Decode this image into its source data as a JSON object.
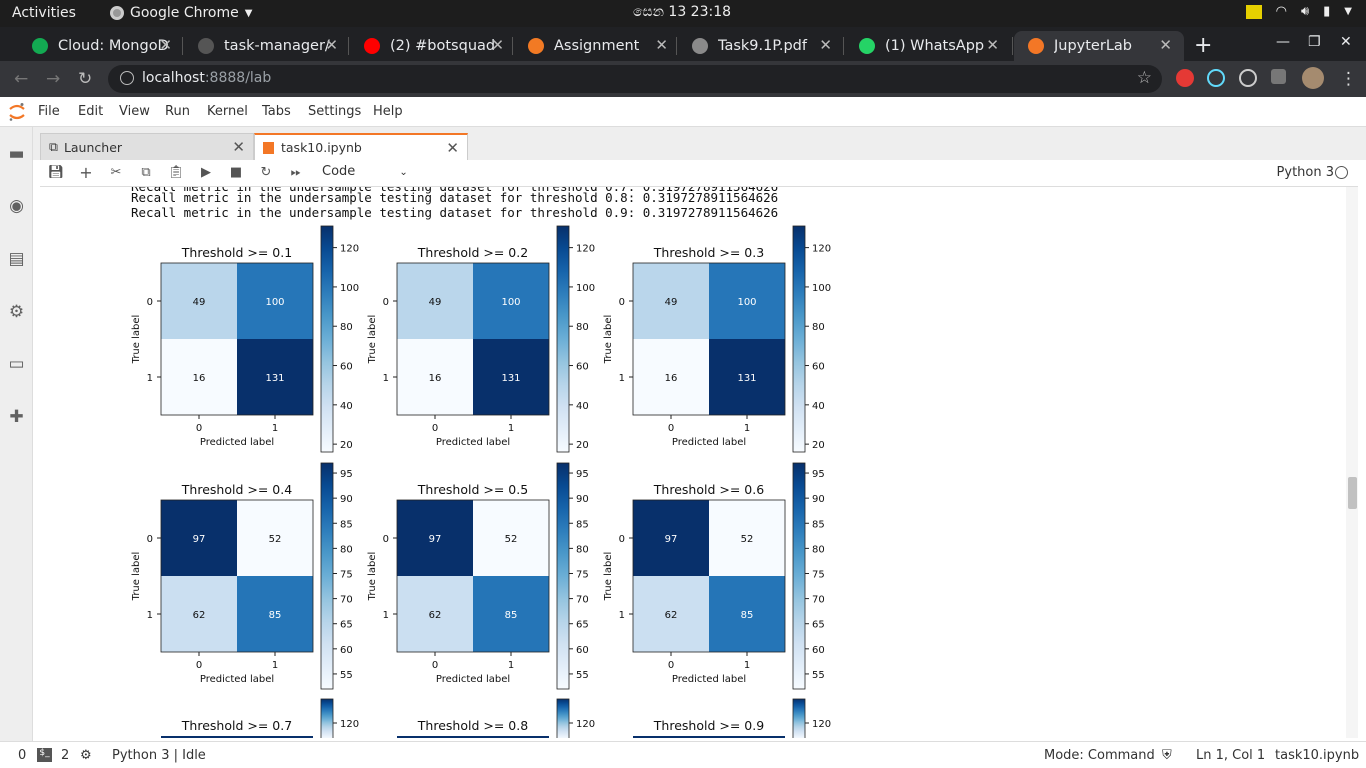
{
  "system_bar": {
    "activities": "Activities",
    "app_name": "Google Chrome",
    "clock": "සෙන  13  23:18"
  },
  "chrome": {
    "tabs": [
      {
        "label": "Cloud: MongoD",
        "favicon_color": "#13aa52"
      },
      {
        "label": "task-manager/",
        "favicon_color": "#555555"
      },
      {
        "label": "(2) #botsquad",
        "favicon_color": "#ff0000"
      },
      {
        "label": "Assignment",
        "favicon_color": "#f27a24"
      },
      {
        "label": "Task9.1P.pdf",
        "favicon_color": "#8a8a8a"
      },
      {
        "label": "(1) WhatsApp",
        "favicon_color": "#25d366"
      },
      {
        "label": "JupyterLab",
        "favicon_color": "#f37726"
      }
    ],
    "active_tab_index": 6,
    "url_host": "localhost",
    "url_rest": ":8888/lab"
  },
  "jupyter": {
    "menu": [
      "File",
      "Edit",
      "View",
      "Run",
      "Kernel",
      "Tabs",
      "Settings",
      "Help"
    ],
    "tabs": [
      {
        "label": "Launcher"
      },
      {
        "label": "task10.ipynb"
      }
    ],
    "cell_type": "Code",
    "kernel_name": "Python 3"
  },
  "output": {
    "lines": [
      "Recall metric in the undersample testing dataset for threshold 0.8: 0.3197278911564626",
      "Recall metric in the undersample testing dataset for threshold 0.9: 0.3197278911564626"
    ]
  },
  "chart_data": [
    {
      "type": "heatmap",
      "title": "Threshold >= 0.1",
      "xlabel": "Predicted label",
      "ylabel": "True label",
      "x_ticks": [
        "0",
        "1"
      ],
      "y_ticks": [
        "0",
        "1"
      ],
      "matrix": [
        [
          49,
          100
        ],
        [
          16,
          131
        ]
      ],
      "colorbar_ticks": [
        20,
        40,
        60,
        80,
        100,
        120
      ],
      "vmin": 16,
      "vmax": 131,
      "colormap": "Blues"
    },
    {
      "type": "heatmap",
      "title": "Threshold >= 0.2",
      "xlabel": "Predicted label",
      "ylabel": "True label",
      "x_ticks": [
        "0",
        "1"
      ],
      "y_ticks": [
        "0",
        "1"
      ],
      "matrix": [
        [
          49,
          100
        ],
        [
          16,
          131
        ]
      ],
      "colorbar_ticks": [
        20,
        40,
        60,
        80,
        100,
        120
      ],
      "vmin": 16,
      "vmax": 131,
      "colormap": "Blues"
    },
    {
      "type": "heatmap",
      "title": "Threshold >= 0.3",
      "xlabel": "Predicted label",
      "ylabel": "True label",
      "x_ticks": [
        "0",
        "1"
      ],
      "y_ticks": [
        "0",
        "1"
      ],
      "matrix": [
        [
          49,
          100
        ],
        [
          16,
          131
        ]
      ],
      "colorbar_ticks": [
        20,
        40,
        60,
        80,
        100,
        120
      ],
      "vmin": 16,
      "vmax": 131,
      "colormap": "Blues"
    },
    {
      "type": "heatmap",
      "title": "Threshold >= 0.4",
      "xlabel": "Predicted label",
      "ylabel": "True label",
      "x_ticks": [
        "0",
        "1"
      ],
      "y_ticks": [
        "0",
        "1"
      ],
      "matrix": [
        [
          97,
          52
        ],
        [
          62,
          85
        ]
      ],
      "colorbar_ticks": [
        55,
        60,
        65,
        70,
        75,
        80,
        85,
        90,
        95
      ],
      "vmin": 52,
      "vmax": 97,
      "colormap": "Blues"
    },
    {
      "type": "heatmap",
      "title": "Threshold >= 0.5",
      "xlabel": "Predicted label",
      "ylabel": "True label",
      "x_ticks": [
        "0",
        "1"
      ],
      "y_ticks": [
        "0",
        "1"
      ],
      "matrix": [
        [
          97,
          52
        ],
        [
          62,
          85
        ]
      ],
      "colorbar_ticks": [
        55,
        60,
        65,
        70,
        75,
        80,
        85,
        90,
        95
      ],
      "vmin": 52,
      "vmax": 97,
      "colormap": "Blues"
    },
    {
      "type": "heatmap",
      "title": "Threshold >= 0.6",
      "xlabel": "Predicted label",
      "ylabel": "True label",
      "x_ticks": [
        "0",
        "1"
      ],
      "y_ticks": [
        "0",
        "1"
      ],
      "matrix": [
        [
          97,
          52
        ],
        [
          62,
          85
        ]
      ],
      "colorbar_ticks": [
        55,
        60,
        65,
        70,
        75,
        80,
        85,
        90,
        95
      ],
      "vmin": 52,
      "vmax": 97,
      "colormap": "Blues"
    },
    {
      "type": "heatmap",
      "title": "Threshold >= 0.7",
      "colorbar_ticks": [
        120
      ],
      "colormap": "Blues"
    },
    {
      "type": "heatmap",
      "title": "Threshold >= 0.8",
      "colorbar_ticks": [
        120
      ],
      "colormap": "Blues"
    },
    {
      "type": "heatmap",
      "title": "Threshold >= 0.9",
      "colorbar_ticks": [
        120
      ],
      "colormap": "Blues"
    }
  ],
  "statusbar": {
    "left_count": "0",
    "terminals": "2",
    "kernel_status": "Python 3 | Idle",
    "mode": "Mode: Command",
    "position": "Ln 1, Col 1",
    "filename": "task10.ipynb"
  }
}
